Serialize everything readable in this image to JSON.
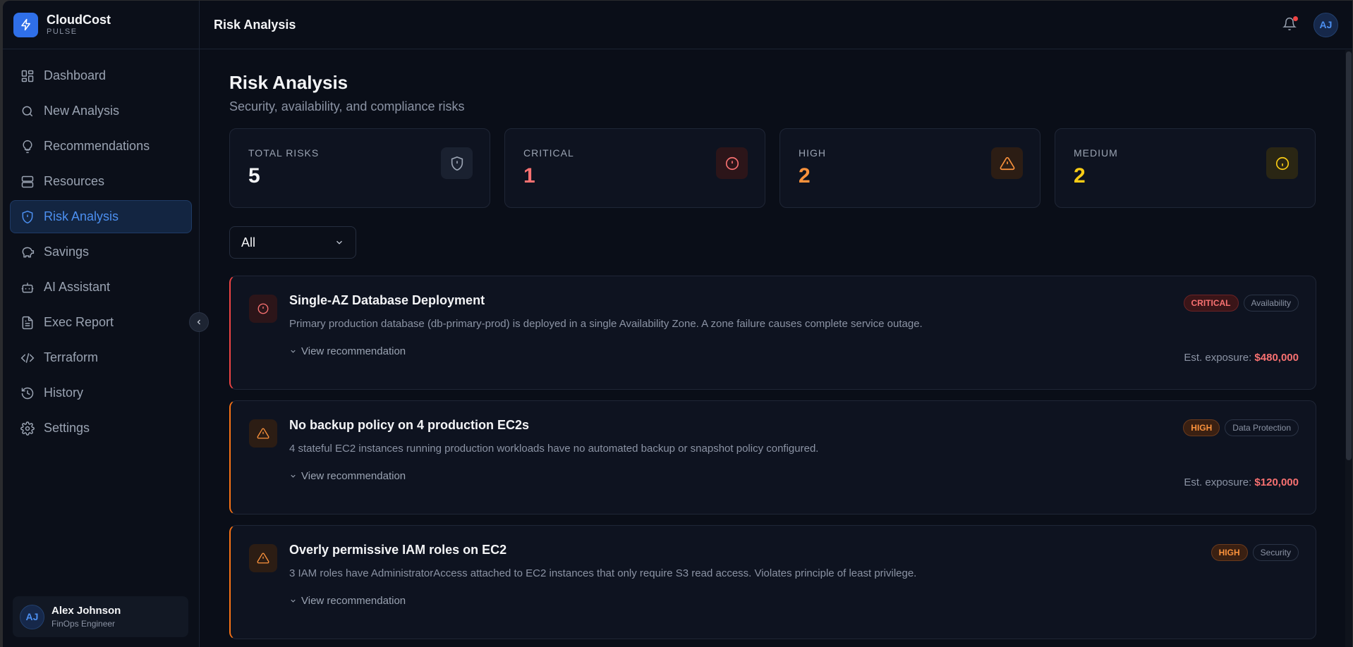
{
  "brand": {
    "name": "CloudCost",
    "sub": "PULSE"
  },
  "nav": [
    {
      "label": "Dashboard",
      "icon": "dashboard-icon"
    },
    {
      "label": "New Analysis",
      "icon": "search-icon"
    },
    {
      "label": "Recommendations",
      "icon": "lightbulb-icon"
    },
    {
      "label": "Resources",
      "icon": "server-icon"
    },
    {
      "label": "Risk Analysis",
      "icon": "shield-icon",
      "active": true
    },
    {
      "label": "Savings",
      "icon": "piggy-bank-icon"
    },
    {
      "label": "AI Assistant",
      "icon": "bot-icon"
    },
    {
      "label": "Exec Report",
      "icon": "file-icon"
    },
    {
      "label": "Terraform",
      "icon": "code-icon"
    },
    {
      "label": "History",
      "icon": "history-icon"
    },
    {
      "label": "Settings",
      "icon": "gear-icon"
    }
  ],
  "user": {
    "initials": "AJ",
    "name": "Alex Johnson",
    "role": "FinOps Engineer"
  },
  "topbar": {
    "title": "Risk Analysis",
    "avatar_initials": "AJ"
  },
  "page": {
    "title": "Risk Analysis",
    "subtitle": "Security, availability, and compliance risks"
  },
  "stats": [
    {
      "label": "TOTAL RISKS",
      "value": "5",
      "color": "#f3f4f6"
    },
    {
      "label": "CRITICAL",
      "value": "1",
      "color": "#f87171"
    },
    {
      "label": "HIGH",
      "value": "2",
      "color": "#fb923c"
    },
    {
      "label": "MEDIUM",
      "value": "2",
      "color": "#facc15"
    }
  ],
  "filter": {
    "selected": "All"
  },
  "risks": [
    {
      "title": "Single-AZ Database Deployment",
      "description": "Primary production database (db-primary-prod) is deployed in a single Availability Zone. A zone failure causes complete service outage.",
      "severity": "CRITICAL",
      "category": "Availability",
      "link": "View recommendation",
      "exposure_label": "Est. exposure:",
      "exposure_value": "$480,000"
    },
    {
      "title": "No backup policy on 4 production EC2s",
      "description": "4 stateful EC2 instances running production workloads have no automated backup or snapshot policy configured.",
      "severity": "HIGH",
      "category": "Data Protection",
      "link": "View recommendation",
      "exposure_label": "Est. exposure:",
      "exposure_value": "$120,000"
    },
    {
      "title": "Overly permissive IAM roles on EC2",
      "description": "3 IAM roles have AdministratorAccess attached to EC2 instances that only require S3 read access. Violates principle of least privilege.",
      "severity": "HIGH",
      "category": "Security",
      "link": "View recommendation"
    }
  ],
  "colors": {
    "accent": "#2f6fe8",
    "critical": "#ef4444",
    "high": "#f97316",
    "medium": "#facc15"
  }
}
